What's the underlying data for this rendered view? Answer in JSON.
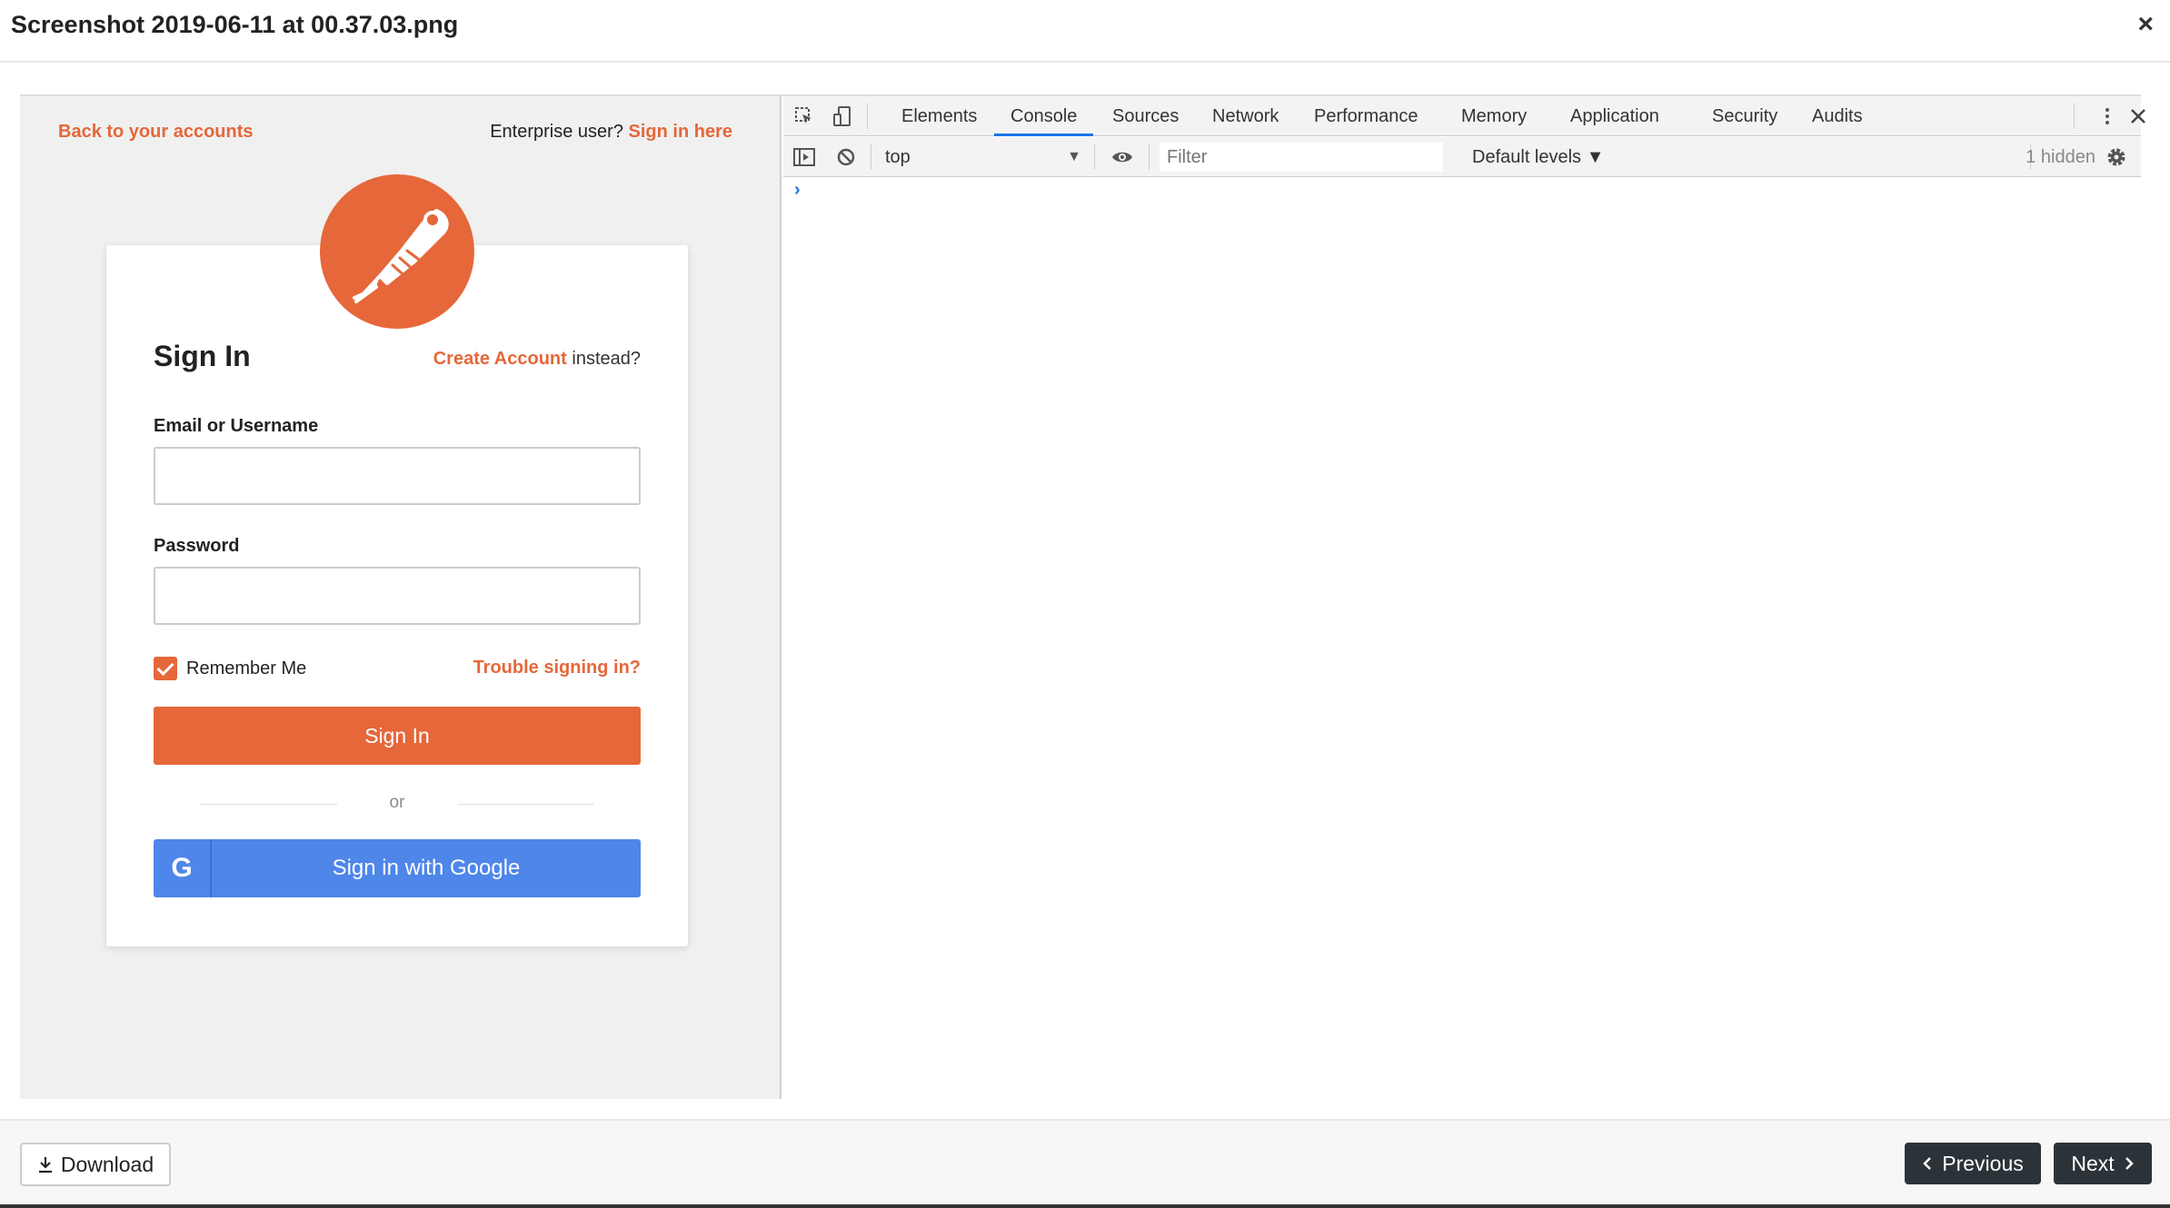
{
  "modal": {
    "title": "Screenshot 2019-06-11 at 00.37.03.png",
    "close_glyph": "×"
  },
  "login": {
    "back_link": "Back to your accounts",
    "enterprise_text": "Enterprise user?",
    "enterprise_link": "Sign in here",
    "logo_icon": "postman-rocket-logo",
    "title": "Sign In",
    "create_link": "Create Account",
    "create_suffix": "instead?",
    "email_label": "Email or Username",
    "email_value": "",
    "password_label": "Password",
    "password_value": "",
    "remember_label": "Remember Me",
    "remember_checked": true,
    "trouble_link": "Trouble signing in?",
    "signin_button": "Sign In",
    "or_text": "or",
    "google_glyph": "G",
    "google_button": "Sign in with Google",
    "brand_color": "#e5673a",
    "google_color": "#4e86ea"
  },
  "devtools": {
    "tabs": [
      "Elements",
      "Console",
      "Sources",
      "Network",
      "Performance",
      "Memory",
      "Application",
      "Security",
      "Audits"
    ],
    "active_tab": "Console",
    "context": "top",
    "filter_placeholder": "Filter",
    "levels": "Default levels ▼",
    "hidden": "1 hidden",
    "prompt": "›"
  },
  "footer": {
    "download": "Download",
    "previous": "Previous",
    "next": "Next"
  }
}
